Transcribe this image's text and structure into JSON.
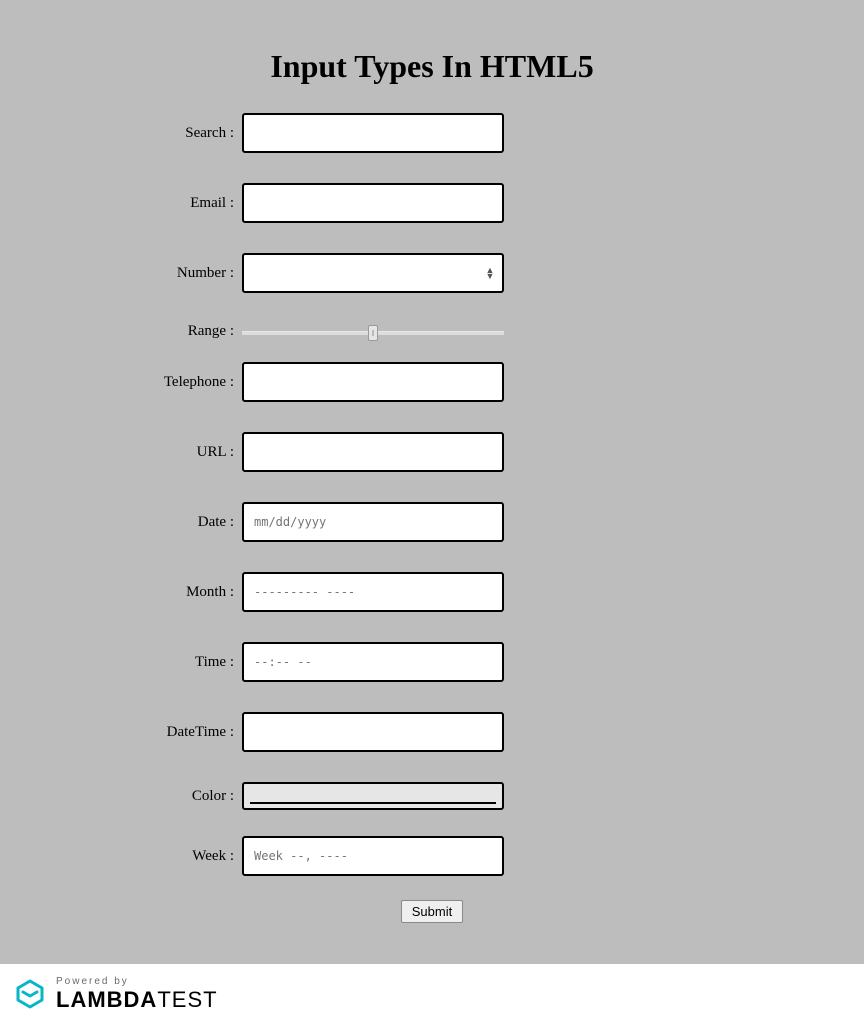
{
  "title": "Input Types In HTML5",
  "fields": {
    "search": {
      "label": "Search :",
      "value": ""
    },
    "email": {
      "label": "Email :",
      "value": ""
    },
    "number": {
      "label": "Number :",
      "value": ""
    },
    "range": {
      "label": "Range :",
      "value": 50,
      "min": 0,
      "max": 100
    },
    "telephone": {
      "label": "Telephone :",
      "value": ""
    },
    "url": {
      "label": "URL :",
      "value": ""
    },
    "date": {
      "label": "Date :",
      "placeholder": "mm/dd/yyyy",
      "value": ""
    },
    "month": {
      "label": "Month :",
      "placeholder": "--------- ----",
      "value": ""
    },
    "time": {
      "label": "Time :",
      "placeholder": "--:-- --",
      "value": ""
    },
    "datetime": {
      "label": "DateTime :",
      "value": ""
    },
    "color": {
      "label": "Color :",
      "value": "#000000"
    },
    "week": {
      "label": "Week :",
      "placeholder": "Week --, ----",
      "value": ""
    }
  },
  "submit_label": "Submit",
  "footer": {
    "powered": "Powered by",
    "brand_bold": "LAMBDA",
    "brand_thin": "TEST"
  }
}
